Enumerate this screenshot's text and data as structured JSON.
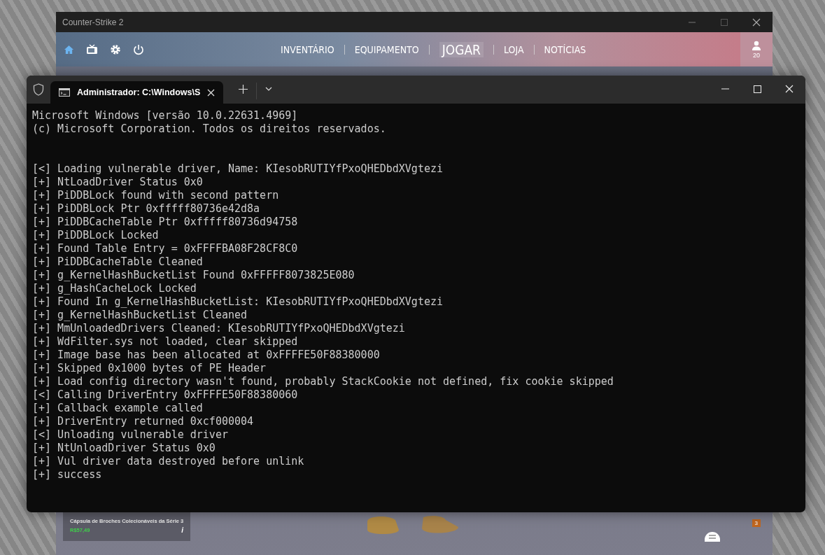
{
  "game_window": {
    "title": "Counter-Strike 2",
    "nav": [
      {
        "label": "INVENTÁRIO",
        "selected": false
      },
      {
        "label": "EQUIPAMENTO",
        "selected": false
      },
      {
        "label": "JOGAR",
        "selected": true
      },
      {
        "label": "LOJA",
        "selected": false
      },
      {
        "label": "NOTÍCIAS",
        "selected": false
      }
    ],
    "friends_count": "20",
    "item_card": {
      "name": "Cápsula de Broches Colecionáveis da Série 3",
      "price": "R$57,49",
      "info": "i"
    },
    "notification_badge": "3"
  },
  "terminal": {
    "tab": {
      "title": "Administrador: C:\\Windows\\S",
      "selected": true
    },
    "blocks": [
      {
        "lines": [
          "Microsoft Windows [versão 10.0.22631.4969]",
          "(c) Microsoft Corporation. Todos os direitos reservados."
        ]
      },
      {
        "lines": [
          "[<] Loading vulnerable driver, Name: KIesobRUTIYfPxoQHEDbdXVgtezi",
          "[+] NtLoadDriver Status 0x0",
          "[+] PiDDBLock found with second pattern",
          "[+] PiDDBLock Ptr 0xfffff80736e42d8a",
          "[+] PiDDBCacheTable Ptr 0xfffff80736d94758",
          "[+] PiDDBLock Locked",
          "[+] Found Table Entry = 0xFFFFBA08F28CF8C0",
          "[+] PiDDBCacheTable Cleaned",
          "[+] g_KernelHashBucketList Found 0xFFFFF8073825E080",
          "[+] g_HashCacheLock Locked",
          "[+] Found In g_KernelHashBucketList: KIesobRUTIYfPxoQHEDbdXVgtezi",
          "[+] g_KernelHashBucketList Cleaned",
          "[+] MmUnloadedDrivers Cleaned: KIesobRUTIYfPxoQHEDbdXVgtezi",
          "[+] WdFilter.sys not loaded, clear skipped",
          "[+] Image base has been allocated at 0xFFFFE50F88380000",
          "[+] Skipped 0x1000 bytes of PE Header",
          "[+] Load config directory wasn't found, probably StackCookie not defined, fix cookie skipped",
          "[<] Calling DriverEntry 0xFFFFE50F88380060",
          "[+] Callback example called",
          "[+] DriverEntry returned 0xcf000004",
          "[<] Unloading vulnerable driver",
          "[+] NtUnloadDriver Status 0x0",
          "[+] Vul driver data destroyed before unlink",
          "[+] success"
        ]
      }
    ]
  }
}
